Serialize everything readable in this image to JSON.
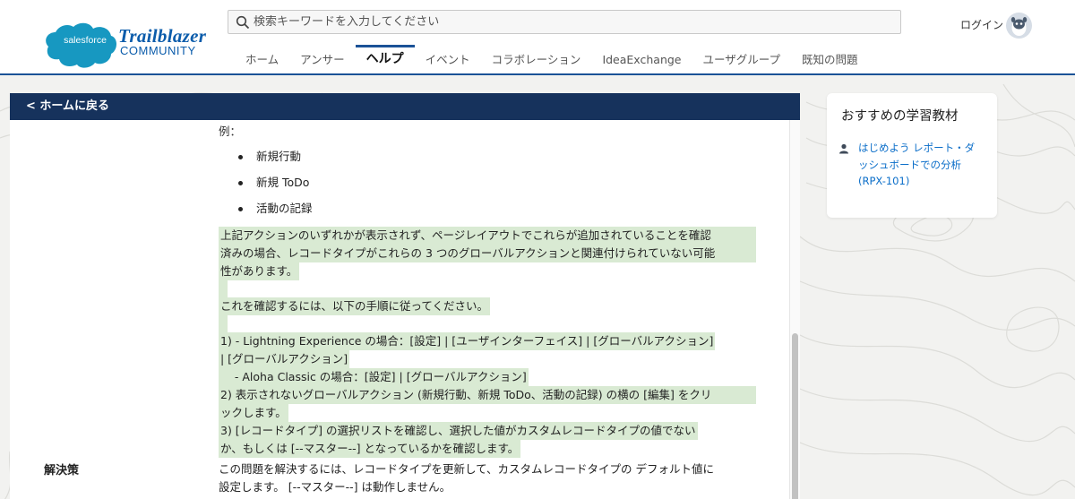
{
  "header": {
    "logo": {
      "brand": "salesforce",
      "title": "Trailblazer",
      "subtitle": "COMMUNITY"
    },
    "search": {
      "placeholder": "検索キーワードを入力してください"
    },
    "login_label": "ログイン",
    "nav": [
      "ホーム",
      "アンサー",
      "ヘルプ",
      "イベント",
      "コラボレーション",
      "IdeaExchange",
      "ユーザグループ",
      "既知の問題"
    ],
    "active_nav": "ヘルプ"
  },
  "article": {
    "back_label": "< ホームに戻る",
    "example_label": "例：",
    "examples": [
      "新規行動",
      "新規 ToDo",
      "活動の記録"
    ],
    "para1_line1": "上記アクションのいずれかが表示されず、ページレイアウトでこれらが追加されていることを確認",
    "para1_line2": "済みの場合、レコードタイプがこれらの 3 つのグローバルアクションと関連付けられていない可能",
    "para1_line3": "性があります。",
    "para2": "これを確認するには、以下の手順に従ってください。",
    "step1_line1": "1) - Lightning Experience の場合：[設定] | [ユーザインターフェイス] | [グローバルアクション]",
    "step1_line2": "| [グローバルアクション]",
    "step1_line3": "    - Aloha Classic の場合：[設定] | [グローバルアクション]",
    "step2_line1": "2) 表示されないグローバルアクション (新規行動、新規 ToDo、活動の記録) の横の [編集] をクリ",
    "step2_line2": "ックします。",
    "step3_line1": "3) [レコードタイプ] の選択リストを確認し、選択した値がカスタムレコードタイプの値でない",
    "step3_line2": "か、もしくは [--マスター--] となっているかを確認します。",
    "solution_label": "解決策",
    "solution_line1": "この問題を解決するには、レコードタイプを更新して、カスタムレコードタイプの デフォルト値に",
    "solution_line2": "設定します。 [--マスター--] は動作しません。"
  },
  "sidebar": {
    "title": "おすすめの学習教材",
    "link_line1": "はじめよう レポート・ダ",
    "link_line2": "ッシュボードでの分析",
    "link_line3": "(RPX-101)"
  }
}
